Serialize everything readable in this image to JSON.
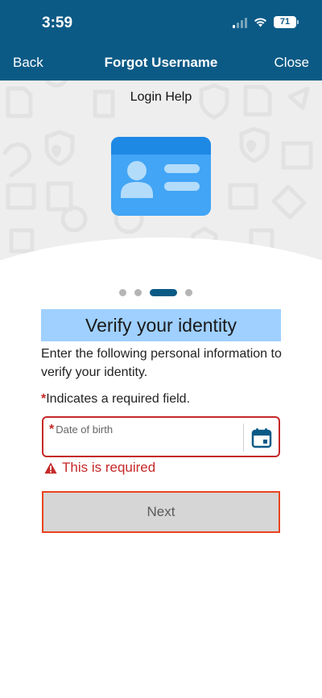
{
  "status_bar": {
    "time": "3:59",
    "battery": "71",
    "signal_bars_on": 1,
    "signal_bars_total": 4
  },
  "nav": {
    "back_label": "Back",
    "title": "Forgot Username",
    "close_label": "Close"
  },
  "hero": {
    "label": "Login Help",
    "illustration": "id-card-icon"
  },
  "pager": {
    "total": 4,
    "active_index": 2
  },
  "content": {
    "heading": "Verify your identity",
    "intro": "Enter the following personal information to verify your identity.",
    "required_star": "*",
    "required_note": "Indicates a required field."
  },
  "form": {
    "dob": {
      "required_star": "*",
      "label": "Date of birth",
      "value": "",
      "calendar_icon": "calendar-icon"
    },
    "error": {
      "icon": "warning-icon",
      "text": "This is required"
    },
    "next_label": "Next"
  },
  "colors": {
    "header": "#0b5a86",
    "highlight": "#9fd0ff",
    "error": "#c62828",
    "focus_border": "#e8431e",
    "card": "#42a5f5"
  }
}
